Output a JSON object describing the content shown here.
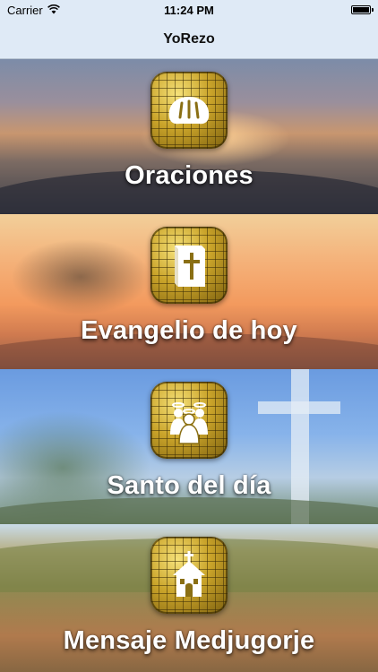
{
  "status_bar": {
    "carrier": "Carrier",
    "time": "11:24 PM",
    "icons": [
      "wifi-icon",
      "battery-icon"
    ]
  },
  "nav": {
    "title": "YoRezo"
  },
  "menu": {
    "items": [
      {
        "label": "Oraciones",
        "icon": "bread-icon"
      },
      {
        "label": "Evangelio de hoy",
        "icon": "bible-icon"
      },
      {
        "label": "Santo del día",
        "icon": "saints-icon"
      },
      {
        "label": "Mensaje Medjugorje",
        "icon": "chapel-icon"
      }
    ]
  },
  "colors": {
    "nav_background": "#dfeaf6",
    "label_text": "#ffffff",
    "icon_gold": "#caa42a"
  }
}
